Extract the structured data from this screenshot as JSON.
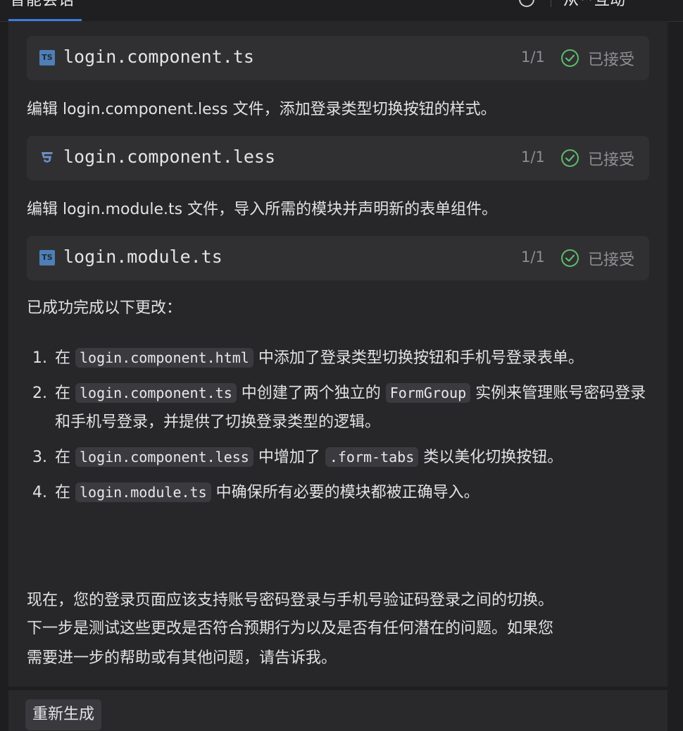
{
  "top_bar": {
    "active_tab": "智能会话",
    "right_label": "从**互动"
  },
  "files": [
    {
      "name": "login.component.ts",
      "type": "ts",
      "count": "1/1",
      "status": "已接受"
    },
    {
      "name": "login.component.less",
      "type": "css",
      "count": "1/1",
      "status": "已接受"
    },
    {
      "name": "login.module.ts",
      "type": "ts",
      "count": "1/1",
      "status": "已接受"
    }
  ],
  "messages": {
    "edit_less": "编辑 login.component.less 文件，添加登录类型切换按钮的样式。",
    "edit_module": "编辑 login.module.ts 文件，导入所需的模块并声明新的表单组件。",
    "summary_intro": "已成功完成以下更改："
  },
  "changes": [
    {
      "num": "1.",
      "pre": "在 ",
      "code": "login.component.html",
      "post": " 中添加了登录类型切换按钮和手机号登录表单。"
    },
    {
      "num": "2.",
      "pre": "在 ",
      "code": "login.component.ts",
      "mid": " 中创建了两个独立的 ",
      "code2": "FormGroup",
      "post": " 实例来管理账号密码登录和手机号登录，并提供了切换登录类型的逻辑。"
    },
    {
      "num": "3.",
      "pre": "在 ",
      "code": "login.component.less",
      "mid": " 中增加了 ",
      "code2": ".form-tabs",
      "post": " 类以美化切换按钮。"
    },
    {
      "num": "4.",
      "pre": "在 ",
      "code": "login.module.ts",
      "post": " 中确保所有必要的模块都被正确导入。"
    }
  ],
  "closing": [
    "现在，您的登录页面应该支持账号密码登录与手机号验证码登录之间的切换。",
    "下一步是测试这些更改是否符合预期行为以及是否有任何潜在的问题。如果您",
    "需要进一步的帮助或有其他问题，请告诉我。"
  ],
  "actions": {
    "regenerate": "重新生成"
  },
  "colors": {
    "accent": "#3d7be0",
    "success": "#5fb96b"
  }
}
